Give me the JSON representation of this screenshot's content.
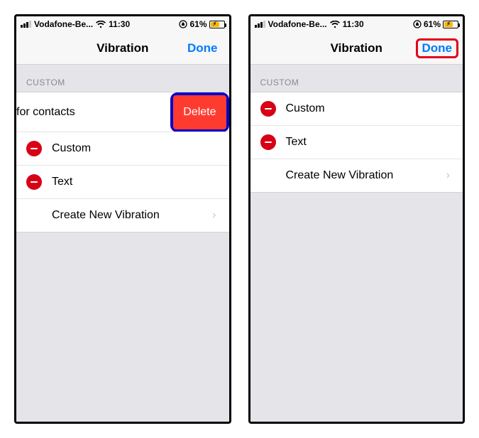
{
  "status": {
    "carrier": "Vodafone-Be...",
    "time": "11:30",
    "battery_pct": "61%"
  },
  "nav": {
    "title": "Vibration",
    "done": "Done"
  },
  "section": {
    "custom_header": "CUSTOM",
    "create_new": "Create New Vibration"
  },
  "left": {
    "shifted_label": "for contacts",
    "delete_label": "Delete",
    "items": [
      {
        "label": "Custom"
      },
      {
        "label": "Text"
      }
    ]
  },
  "right": {
    "items": [
      {
        "label": "Custom"
      },
      {
        "label": "Text"
      }
    ]
  }
}
